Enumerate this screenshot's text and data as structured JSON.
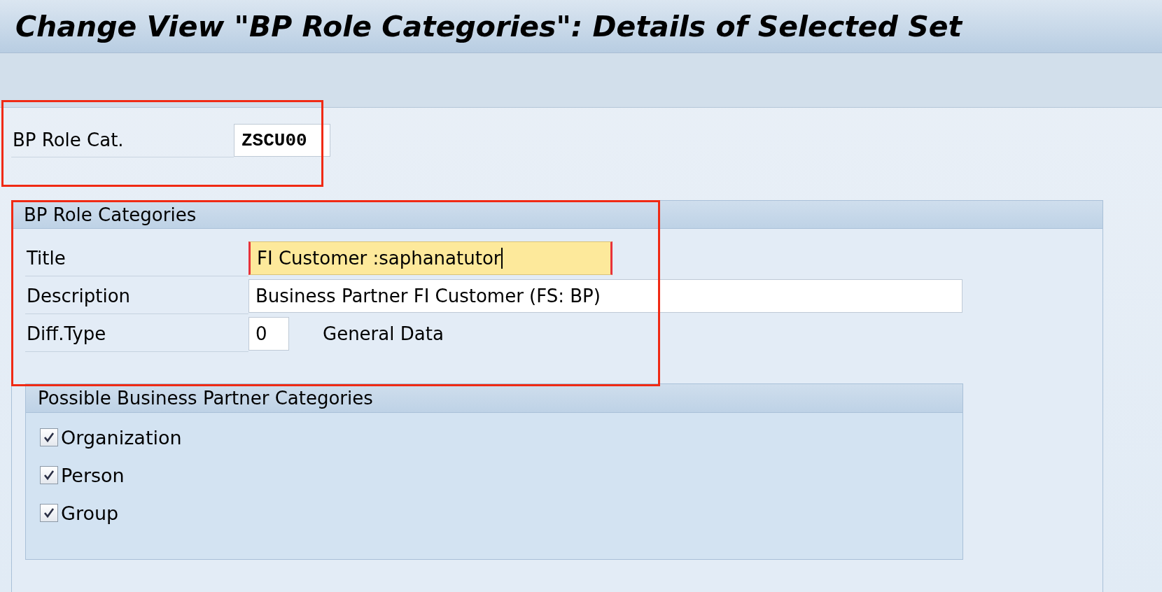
{
  "window": {
    "title": "Change View \"BP Role Categories\": Details of Selected Set"
  },
  "key_field": {
    "label": "BP Role Cat.",
    "value": "ZSCU00",
    "highlighted": true
  },
  "group": {
    "title": "BP Role Categories",
    "highlighted": true,
    "fields": [
      {
        "label": "Title",
        "value": "FI Customer :saphanatutor",
        "kind": "focused"
      },
      {
        "label": "Description",
        "value": "Business Partner FI Customer (FS: BP)",
        "kind": "wide"
      },
      {
        "label": "Diff.Type",
        "value": "0",
        "kind": "short",
        "note": "General Data"
      }
    ]
  },
  "categories": {
    "title": "Possible Business Partner Categories",
    "items": [
      {
        "label": "Organization",
        "checked": true
      },
      {
        "label": "Person",
        "checked": true
      },
      {
        "label": "Group",
        "checked": true
      }
    ]
  }
}
